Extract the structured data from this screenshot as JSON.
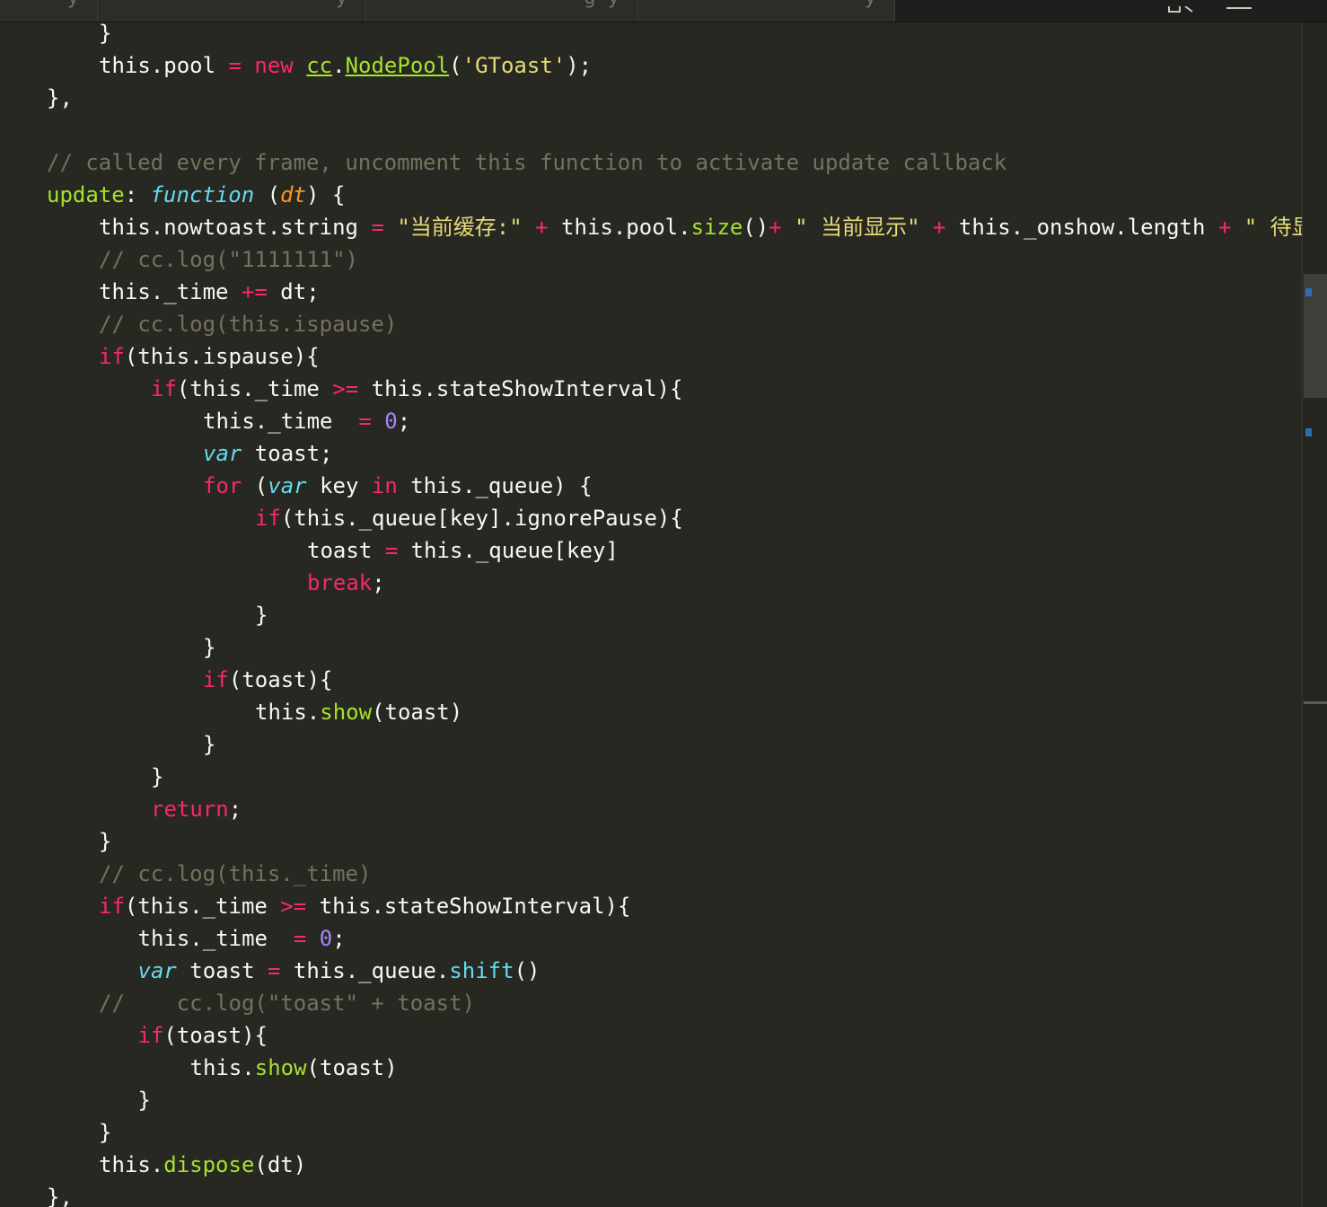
{
  "window": {
    "tabs": [
      {
        "label": "y"
      },
      {
        "label": "y"
      },
      {
        "label": "g y"
      },
      {
        "label": "y"
      }
    ]
  },
  "toolbar": {
    "icons": [
      "search-icon",
      "menu-icon"
    ]
  },
  "editor": {
    "language": "javascript",
    "theme_colors": {
      "background": "#272822",
      "keyword": "#f92672",
      "string": "#e6db74",
      "comment": "#75715e",
      "function_name": "#a6e22e",
      "storage": "#66d9ef",
      "parameter": "#fd971f",
      "number": "#ae81ff",
      "text": "#f8f8f2"
    },
    "lines": [
      {
        "indent": 2,
        "tokens": [
          [
            "t",
            "}"
          ]
        ]
      },
      {
        "indent": 2,
        "tokens": [
          [
            "t",
            "this.pool "
          ],
          [
            "k",
            "="
          ],
          [
            "t",
            " "
          ],
          [
            "k",
            "new"
          ],
          [
            "t",
            " "
          ],
          [
            "fu",
            "cc"
          ],
          [
            "t",
            "."
          ],
          [
            "fu",
            "NodePool"
          ],
          [
            "t",
            "("
          ],
          [
            "s",
            "'GToast'"
          ],
          [
            "t",
            ");"
          ]
        ]
      },
      {
        "indent": 1,
        "tokens": [
          [
            "t",
            "},"
          ]
        ]
      },
      {
        "indent": 1,
        "tokens": []
      },
      {
        "indent": 1,
        "tokens": [
          [
            "c",
            "// called every frame, uncomment this function to activate update callback"
          ]
        ]
      },
      {
        "indent": 1,
        "tokens": [
          [
            "f",
            "update"
          ],
          [
            "t",
            ": "
          ],
          [
            "sf",
            "function"
          ],
          [
            "t",
            " ("
          ],
          [
            "p",
            "dt"
          ],
          [
            "t",
            ") {"
          ]
        ]
      },
      {
        "indent": 2,
        "tokens": [
          [
            "t",
            "this.nowtoast.string "
          ],
          [
            "k",
            "="
          ],
          [
            "t",
            " "
          ],
          [
            "s",
            "\"当前缓存:\""
          ],
          [
            "t",
            " "
          ],
          [
            "k",
            "+"
          ],
          [
            "t",
            " this.pool."
          ],
          [
            "f",
            "size"
          ],
          [
            "t",
            "()"
          ],
          [
            "k",
            "+"
          ],
          [
            "t",
            " "
          ],
          [
            "s",
            "\" 当前显示\""
          ],
          [
            "t",
            " "
          ],
          [
            "k",
            "+"
          ],
          [
            "t",
            " this._onshow.length "
          ],
          [
            "k",
            "+"
          ],
          [
            "t",
            " "
          ],
          [
            "s",
            "\" 待显示"
          ]
        ]
      },
      {
        "indent": 2,
        "tokens": [
          [
            "c",
            "// cc.log(\"1111111\")"
          ]
        ]
      },
      {
        "indent": 2,
        "tokens": [
          [
            "t",
            "this._time "
          ],
          [
            "k",
            "+="
          ],
          [
            "t",
            " dt;"
          ]
        ]
      },
      {
        "indent": 2,
        "tokens": [
          [
            "c",
            "// cc.log(this.ispause)"
          ]
        ]
      },
      {
        "indent": 2,
        "tokens": [
          [
            "k",
            "if"
          ],
          [
            "t",
            "(this.ispause){"
          ]
        ]
      },
      {
        "indent": 3,
        "tokens": [
          [
            "k",
            "if"
          ],
          [
            "t",
            "(this._time "
          ],
          [
            "k",
            ">="
          ],
          [
            "t",
            " this.stateShowInterval){"
          ]
        ]
      },
      {
        "indent": 4,
        "tokens": [
          [
            "t",
            "this._time  "
          ],
          [
            "k",
            "="
          ],
          [
            "t",
            " "
          ],
          [
            "n",
            "0"
          ],
          [
            "t",
            ";"
          ]
        ]
      },
      {
        "indent": 4,
        "tokens": [
          [
            "sf",
            "var"
          ],
          [
            "t",
            " toast;"
          ]
        ]
      },
      {
        "indent": 4,
        "tokens": [
          [
            "k",
            "for"
          ],
          [
            "t",
            " ("
          ],
          [
            "sf",
            "var"
          ],
          [
            "t",
            " key "
          ],
          [
            "k",
            "in"
          ],
          [
            "t",
            " this._queue) {"
          ]
        ]
      },
      {
        "indent": 5,
        "tokens": [
          [
            "k",
            "if"
          ],
          [
            "t",
            "(this._queue[key].ignorePause){"
          ]
        ]
      },
      {
        "indent": 6,
        "tokens": [
          [
            "t",
            "toast "
          ],
          [
            "k",
            "="
          ],
          [
            "t",
            " this._queue[key]"
          ]
        ]
      },
      {
        "indent": 6,
        "tokens": [
          [
            "k",
            "break"
          ],
          [
            "t",
            ";"
          ]
        ]
      },
      {
        "indent": 5,
        "tokens": [
          [
            "t",
            "}"
          ]
        ]
      },
      {
        "indent": 4,
        "tokens": [
          [
            "t",
            "}"
          ]
        ]
      },
      {
        "indent": 4,
        "tokens": [
          [
            "k",
            "if"
          ],
          [
            "t",
            "(toast){"
          ]
        ]
      },
      {
        "indent": 5,
        "tokens": [
          [
            "t",
            "this."
          ],
          [
            "f",
            "show"
          ],
          [
            "t",
            "(toast)"
          ]
        ]
      },
      {
        "indent": 4,
        "tokens": [
          [
            "t",
            "}"
          ]
        ]
      },
      {
        "indent": 3,
        "tokens": [
          [
            "t",
            "}"
          ]
        ]
      },
      {
        "indent": 3,
        "tokens": [
          [
            "k",
            "return"
          ],
          [
            "t",
            ";"
          ]
        ]
      },
      {
        "indent": 2,
        "tokens": [
          [
            "t",
            "}"
          ]
        ]
      },
      {
        "indent": 2,
        "tokens": [
          [
            "c",
            "// cc.log(this._time)"
          ]
        ]
      },
      {
        "indent": 2,
        "tokens": [
          [
            "k",
            "if"
          ],
          [
            "t",
            "(this._time "
          ],
          [
            "k",
            ">="
          ],
          [
            "t",
            " this.stateShowInterval){"
          ]
        ]
      },
      {
        "indent": 2.75,
        "tokens": [
          [
            "t",
            "this._time  "
          ],
          [
            "k",
            "="
          ],
          [
            "t",
            " "
          ],
          [
            "n",
            "0"
          ],
          [
            "t",
            ";"
          ]
        ]
      },
      {
        "indent": 2.75,
        "tokens": [
          [
            "sf",
            "var"
          ],
          [
            "t",
            " toast "
          ],
          [
            "k",
            "="
          ],
          [
            "t",
            " this._queue."
          ],
          [
            "b",
            "shift"
          ],
          [
            "t",
            "()"
          ]
        ]
      },
      {
        "indent": 2,
        "tokens": [
          [
            "c",
            "//    cc.log(\"toast\" + toast)"
          ]
        ]
      },
      {
        "indent": 2.75,
        "tokens": [
          [
            "k",
            "if"
          ],
          [
            "t",
            "(toast){"
          ]
        ]
      },
      {
        "indent": 3.75,
        "tokens": [
          [
            "t",
            "this."
          ],
          [
            "f",
            "show"
          ],
          [
            "t",
            "(toast)"
          ]
        ]
      },
      {
        "indent": 2.75,
        "tokens": [
          [
            "t",
            "}"
          ]
        ]
      },
      {
        "indent": 2,
        "tokens": [
          [
            "t",
            "}"
          ]
        ]
      },
      {
        "indent": 2,
        "tokens": [
          [
            "t",
            "this."
          ],
          [
            "f",
            "dispose"
          ],
          [
            "t",
            "(dt)"
          ]
        ]
      },
      {
        "indent": 1,
        "tokens": [
          [
            "t",
            "},"
          ]
        ]
      },
      {
        "indent": 1,
        "tokens": []
      }
    ]
  }
}
